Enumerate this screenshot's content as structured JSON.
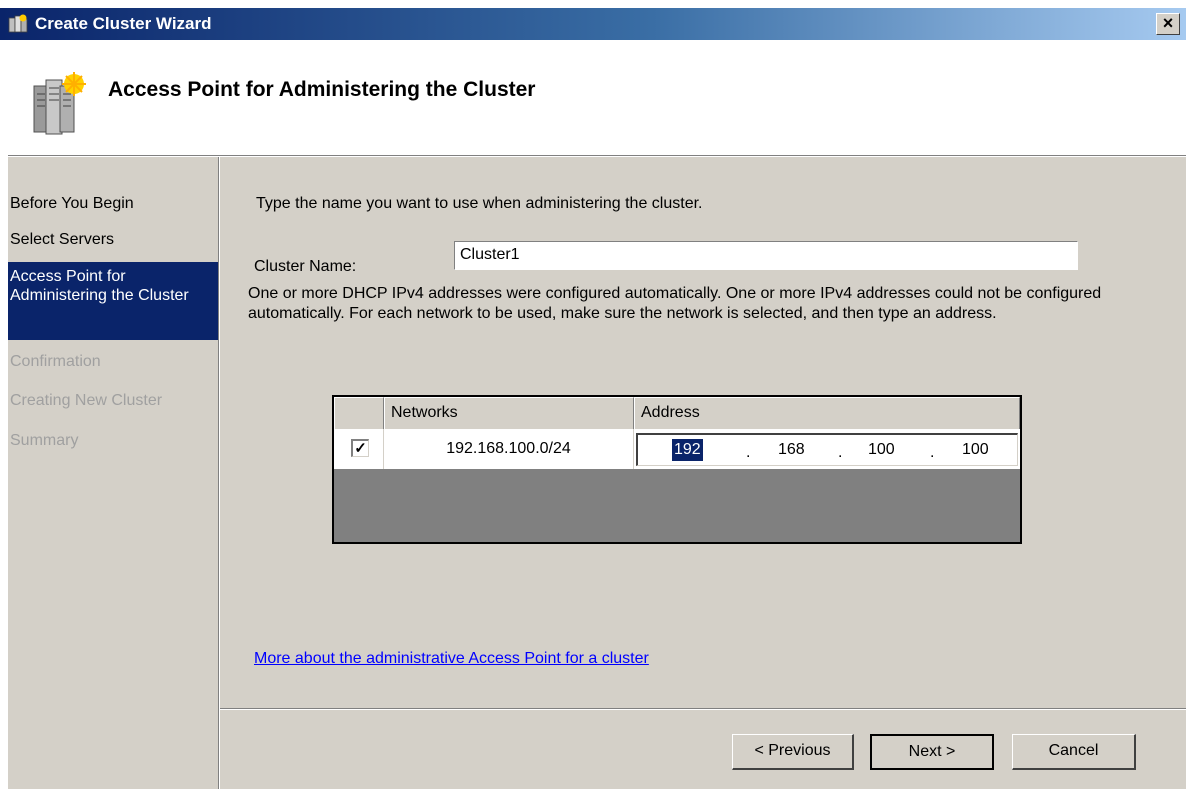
{
  "window": {
    "title": "Create Cluster Wizard",
    "close_label": "×"
  },
  "header": {
    "title": "Access Point for Administering the Cluster",
    "icon": "cluster-servers-icon"
  },
  "sidebar": {
    "steps": [
      {
        "label": "Before You Begin",
        "state": "done"
      },
      {
        "label": "Select Servers",
        "state": "done"
      },
      {
        "label": "Access Point for Administering the Cluster",
        "state": "active"
      },
      {
        "label": "Confirmation",
        "state": "disabled"
      },
      {
        "label": "Creating New Cluster",
        "state": "disabled"
      },
      {
        "label": "Summary",
        "state": "disabled"
      }
    ]
  },
  "main": {
    "instruction": "Type the name you want to use when administering the cluster.",
    "cluster_name_label": "Cluster Name:",
    "cluster_name_value": "Cluster1",
    "info": "One or more DHCP IPv4 addresses were configured automatically.  One or more IPv4 addresses could not be configured automatically.  For each network to be used, make sure the network is selected, and then type an address.",
    "grid": {
      "columns": [
        "",
        "Networks",
        "Address"
      ],
      "rows": [
        {
          "checked": true,
          "check_mark": "✓",
          "network": "192.168.100.0/24",
          "address": [
            "192",
            "168",
            "100",
            "100"
          ]
        }
      ],
      "octet_separator": "."
    },
    "link": "More about the administrative Access Point for a cluster"
  },
  "footer": {
    "previous": "< Previous",
    "next": "Next >",
    "cancel": "Cancel"
  },
  "colors": {
    "title_bar": "#0a246a",
    "selection": "#0a246a",
    "face": "#d4d0c8",
    "link": "#0000ff"
  }
}
